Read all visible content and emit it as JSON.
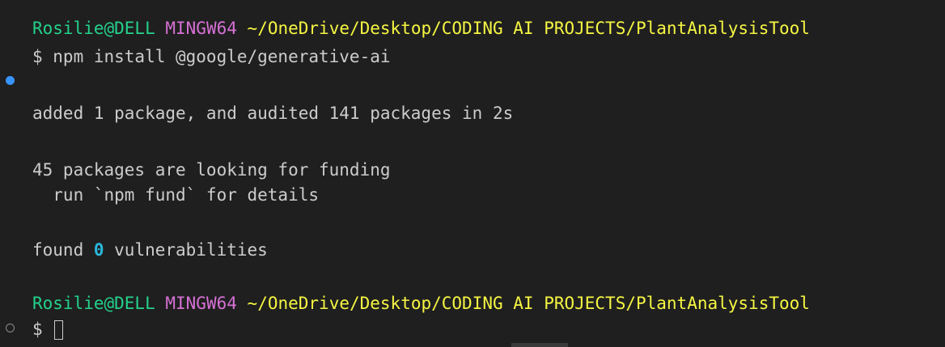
{
  "prompt1": {
    "user": "Rosilie@DELL",
    "host": "MINGW64",
    "path": "~/OneDrive/Desktop/CODING AI PROJECTS/PlantAnalysisTool"
  },
  "command": "$ npm install @google/generative-ai",
  "output": {
    "added": "added 1 package, and audited 141 packages in 2s",
    "funding": "45 packages are looking for funding",
    "fund_hint": "  run `npm fund` for details",
    "found_prefix": "found ",
    "vuln_count": "0",
    "found_suffix": " vulnerabilities"
  },
  "prompt2": {
    "user": "Rosilie@DELL",
    "host": "MINGW64",
    "path": "~/OneDrive/Desktop/CODING AI PROJECTS/PlantAnalysisTool",
    "symbol": "$ "
  },
  "colors": {
    "background": "#1f1f1f",
    "user": "#23d18b",
    "host": "#d670d6",
    "path": "#f5f543",
    "number": "#29b8db",
    "text": "#cccccc",
    "decoration_success": "#3794ff"
  }
}
